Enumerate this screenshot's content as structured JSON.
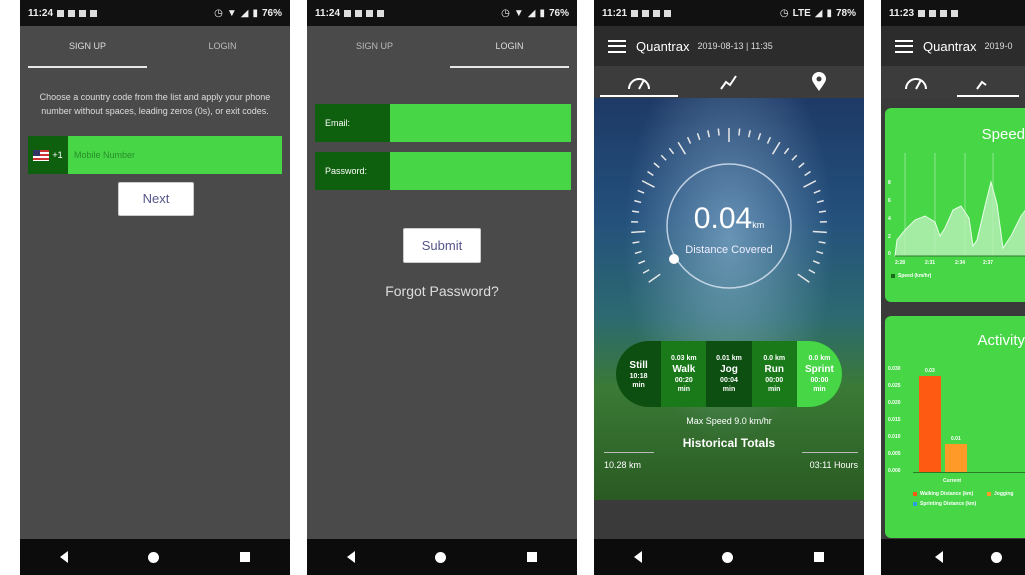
{
  "screens": [
    {
      "status": {
        "time": "11:24",
        "battery": "76%"
      },
      "tabs": [
        "SIGN UP",
        "LOGIN"
      ],
      "instruction": "Choose a country code from the list and apply your phone number without spaces, leading zeros (0s), or exit codes.",
      "country_code": "+1",
      "mobile_placeholder": "Mobile Number",
      "next_label": "Next"
    },
    {
      "status": {
        "time": "11:24",
        "battery": "76%"
      },
      "tabs": [
        "SIGN UP",
        "LOGIN"
      ],
      "email_label": "Email:",
      "password_label": "Password:",
      "submit_label": "Submit",
      "forgot_label": "Forgot Password?"
    },
    {
      "status": {
        "time": "11:21",
        "network": "LTE",
        "battery": "78%"
      },
      "app_title": "Quantrax",
      "datetime": "2019-08-13 | 11:35",
      "distance_value": "0.04",
      "distance_unit": "km",
      "distance_label": "Distance Covered",
      "activities": [
        {
          "dist": "",
          "name": "Still",
          "time": "10:18",
          "unit": "min"
        },
        {
          "dist": "0.03 km",
          "name": "Walk",
          "time": "00:20",
          "unit": "min"
        },
        {
          "dist": "0.01 km",
          "name": "Jog",
          "time": "00:04",
          "unit": "min"
        },
        {
          "dist": "0.0 km",
          "name": "Run",
          "time": "00:00",
          "unit": "min"
        },
        {
          "dist": "0.0 km",
          "name": "Sprint",
          "time": "00:00",
          "unit": "min"
        }
      ],
      "max_speed": "Max Speed 9.0 km/hr",
      "historical": "Historical Totals",
      "total_distance": "10.28 km",
      "total_time": "03:11 Hours"
    },
    {
      "status": {
        "time": "11:23"
      },
      "app_title": "Quantrax",
      "datetime": "2019-0",
      "speed_title": "Speed",
      "speed_ticks_x": [
        "2:28",
        "2:31",
        "2:34",
        "2:37"
      ],
      "speed_ticks_y": [
        "8",
        "6",
        "4",
        "2",
        "0"
      ],
      "speed_legend": "Speed (km/hr)",
      "activity_title": "Activity",
      "activity_ticks_y": [
        "0.030",
        "0.025",
        "0.020",
        "0.015",
        "0.010",
        "0.005",
        "0.000"
      ],
      "activity_bar_labels": [
        "0.03",
        "0.01"
      ],
      "activity_xlabel": "Current",
      "activity_legend": [
        "Walking Distance (km)",
        "Jogging",
        "Sprinting Distance (km)"
      ],
      "colors": {
        "walking": "#ff5a12",
        "jogging": "#ff9a28",
        "sprinting": "#2aa0e0"
      }
    }
  ]
}
